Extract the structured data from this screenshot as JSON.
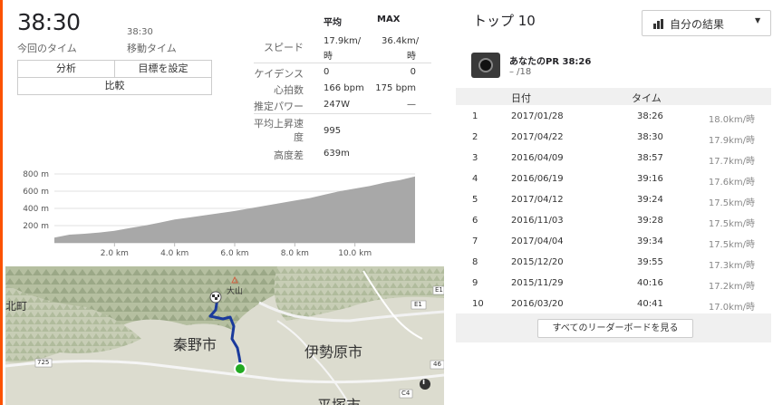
{
  "summary": {
    "elapsed_time": "38:30",
    "elapsed_label": "今回のタイム",
    "moving_time": "38:30",
    "moving_label": "移動タイム",
    "buttons": {
      "analysis": "分析",
      "set_goal": "目標を設定",
      "compare": "比較"
    }
  },
  "stats": {
    "headers": {
      "avg": "平均",
      "max": "MAX"
    },
    "rows": [
      {
        "label": "スピード",
        "avg": "17.9km/時",
        "max": "36.4km/時"
      },
      {
        "label": "ケイデンス",
        "avg": "0",
        "max": "0"
      },
      {
        "label": "心拍数",
        "avg": "166 bpm",
        "max": "175 bpm"
      },
      {
        "label": "推定パワー",
        "avg": "247W",
        "max": "—"
      },
      {
        "label": "平均上昇速度",
        "avg": "995",
        "max": ""
      },
      {
        "label": "高度差",
        "avg": "639m",
        "max": ""
      }
    ]
  },
  "chart_data": {
    "type": "area",
    "title": "",
    "xlabel": "",
    "ylabel": "",
    "x": [
      0,
      0.5,
      1,
      1.5,
      2,
      2.5,
      3,
      3.5,
      4,
      4.5,
      5,
      5.5,
      6,
      6.5,
      7,
      7.5,
      8,
      8.5,
      9,
      9.5,
      10,
      10.5,
      11,
      11.5,
      12
    ],
    "series": [
      {
        "values": [
          60,
          95,
          105,
          120,
          140,
          170,
          200,
          235,
          270,
          295,
          320,
          345,
          370,
          400,
          430,
          460,
          490,
          520,
          560,
          600,
          630,
          660,
          700,
          730,
          770
        ]
      }
    ],
    "x_ticks": [
      "2.0 km",
      "4.0 km",
      "6.0 km",
      "8.0 km",
      "10.0 km"
    ],
    "y_ticks": [
      "800 m",
      "600 m",
      "400 m",
      "200 m"
    ],
    "xlim": [
      0,
      12
    ],
    "ylim": [
      0,
      800
    ],
    "grid": true,
    "fill_color": "#a8a8a8"
  },
  "map": {
    "city1": "秦野市",
    "city2": "伊勢原市",
    "city3": "平塚市",
    "mountain": "大山",
    "west": "北町",
    "route_725": "725",
    "route_e1": "E1",
    "route_e1b": "E1",
    "route_46": "46",
    "route_c4": "C4",
    "info": "i",
    "route_color": "#1a3a9c",
    "start_color": "#22aa22"
  },
  "leaderboard": {
    "title": "トップ 10",
    "filter_label": "自分の結果",
    "pr_label": "あなたのPR 38:26",
    "pr_rank": "– /18",
    "col_date": "日付",
    "col_time": "タイム",
    "rows": [
      {
        "rank": "1",
        "date": "2017/01/28",
        "time": "38:26",
        "speed": "18.0km/時"
      },
      {
        "rank": "2",
        "date": "2017/04/22",
        "time": "38:30",
        "speed": "17.9km/時"
      },
      {
        "rank": "3",
        "date": "2016/04/09",
        "time": "38:57",
        "speed": "17.7km/時"
      },
      {
        "rank": "4",
        "date": "2016/06/19",
        "time": "39:16",
        "speed": "17.6km/時"
      },
      {
        "rank": "5",
        "date": "2017/04/12",
        "time": "39:24",
        "speed": "17.5km/時"
      },
      {
        "rank": "6",
        "date": "2016/11/03",
        "time": "39:28",
        "speed": "17.5km/時"
      },
      {
        "rank": "7",
        "date": "2017/04/04",
        "time": "39:34",
        "speed": "17.5km/時"
      },
      {
        "rank": "8",
        "date": "2015/12/20",
        "time": "39:55",
        "speed": "17.3km/時"
      },
      {
        "rank": "9",
        "date": "2015/11/29",
        "time": "40:16",
        "speed": "17.2km/時"
      },
      {
        "rank": "10",
        "date": "2016/03/20",
        "time": "40:41",
        "speed": "17.0km/時"
      }
    ],
    "view_all": "すべてのリーダーボードを見る"
  }
}
